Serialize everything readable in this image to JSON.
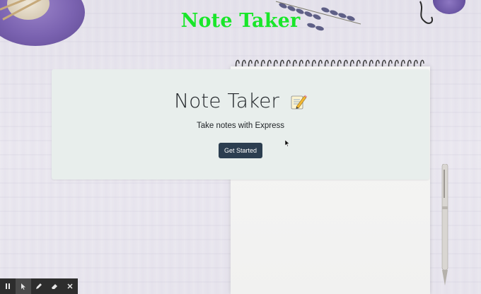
{
  "site": {
    "title": "Note Taker"
  },
  "hero": {
    "title": "Note Taker",
    "subtitle": "Take notes with Express",
    "button_label": "Get Started",
    "icon": "memo-icon"
  },
  "toolbar": {
    "items": [
      "pause-icon",
      "pointer-icon",
      "pencil-icon",
      "eraser-icon",
      "close-icon"
    ],
    "active": "pointer-icon"
  },
  "colors": {
    "title_green": "#19e62a",
    "button_bg": "#2c3e50",
    "hero_bg": "#e8eeec",
    "toolbar_bg": "#2d2d2d"
  }
}
